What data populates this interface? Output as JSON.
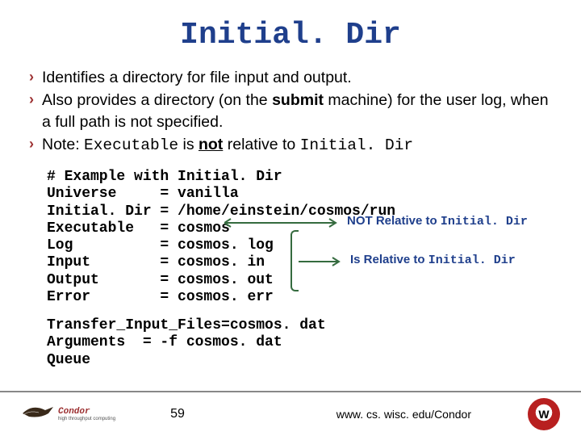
{
  "title": "Initial. Dir",
  "bullets": [
    {
      "html": "Identifies a directory for file input and output."
    },
    {
      "html": "Also provides a directory (on the <b>submit</b> machine) for the user log, when a full path is not specified."
    },
    {
      "html": "Note: <span class=\"mono\">Executable</span> is <b class=\"underline\">not</b> relative to <span class=\"mono\">Initial. Dir</span>"
    }
  ],
  "example_comment": "# Example with Initial. Dir",
  "example_rows": [
    {
      "key": "Universe",
      "eq": "=",
      "val": "vanilla"
    },
    {
      "key": "Initial. Dir",
      "eq": "=",
      "val": "/home/einstein/cosmos/run"
    },
    {
      "key": "Executable",
      "eq": "=",
      "val": "cosmos"
    },
    {
      "key": "Log",
      "eq": "=",
      "val": "cosmos. log"
    },
    {
      "key": "Input",
      "eq": "=",
      "val": "cosmos. in"
    },
    {
      "key": "Output",
      "eq": "=",
      "val": "cosmos. out"
    },
    {
      "key": "Error",
      "eq": "=",
      "val": "cosmos. err"
    }
  ],
  "example_tail": [
    "Transfer_Input_Files=cosmos. dat",
    "Arguments  = -f cosmos. dat",
    "Queue"
  ],
  "annot_not": {
    "bold": "NOT",
    "text": " Relative to ",
    "mono": "Initial. Dir"
  },
  "annot_is": {
    "bold": "Is",
    "text": " Relative to ",
    "mono": "Initial. Dir"
  },
  "footer": {
    "product": "Condor",
    "subline": "high throughput computing",
    "slide_number": "59",
    "url": "www. cs. wisc. edu/Condor",
    "wisc_logo_letter": "W"
  }
}
